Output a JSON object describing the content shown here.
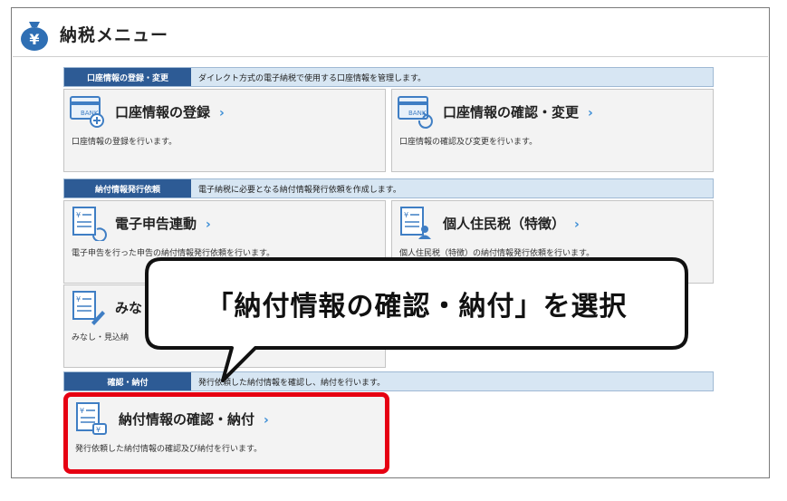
{
  "header": {
    "title": "納税メニュー",
    "icon": "yen-moneybag-icon"
  },
  "sections": [
    {
      "tag": "口座情報の登録・変更",
      "description": "ダイレクト方式の電子納税で使用する口座情報を管理します。"
    },
    {
      "tag": "納付情報発行依頼",
      "description": "電子納税に必要となる納付情報発行依頼を作成します。"
    },
    {
      "tag": "確認・納付",
      "description": "発行依頼した納付情報を確認し、納付を行います。"
    }
  ],
  "cards": {
    "account_register": {
      "title": "口座情報の登録",
      "chevron": "›",
      "description": "口座情報の登録を行います。",
      "icon": "bank-card-add-icon"
    },
    "account_confirm": {
      "title": "口座情報の確認・変更",
      "chevron": "›",
      "description": "口座情報の確認及び変更を行います。",
      "icon": "bank-card-refresh-icon"
    },
    "etax_link": {
      "title": "電子申告連動",
      "chevron": "›",
      "description": "電子申告を行った申告の納付情報発行依頼を行います。",
      "icon": "document-sync-icon"
    },
    "resident_tax": {
      "title": "個人住民税（特徴）",
      "chevron": "›",
      "description": "個人住民税（特徴）の納付情報発行依頼を行います。",
      "icon": "document-person-icon"
    },
    "minashi": {
      "title": "みなし",
      "chevron": "",
      "description": "みなし・見込納",
      "icon": "document-pen-icon"
    },
    "payment_confirm": {
      "title": "納付情報の確認・納付",
      "chevron": "›",
      "description": "発行依頼した納付情報の確認及び納付を行います。",
      "icon": "document-yen-icon"
    }
  },
  "callout": {
    "text": "「納付情報の確認・納付」を選択"
  },
  "colors": {
    "highlight": "#e60012",
    "section_tag": "#2d5b95",
    "section_bar": "#d7e6f3",
    "chevron": "#3c8ed6"
  }
}
